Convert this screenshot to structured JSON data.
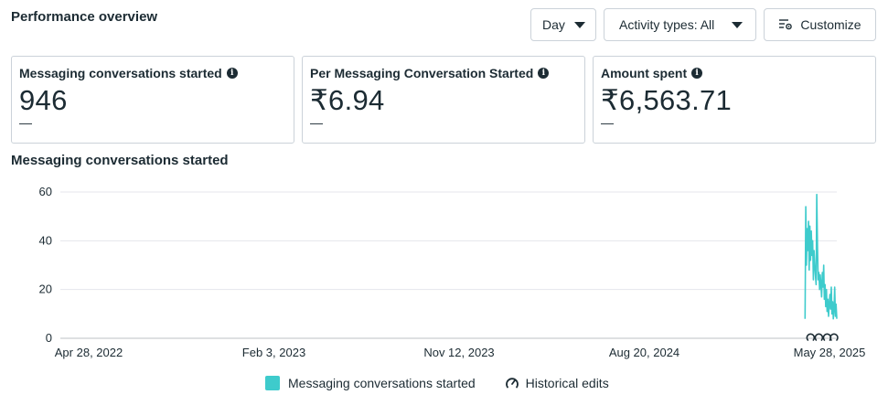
{
  "header": {
    "title": "Performance overview",
    "day_button": "Day",
    "activity_button": "Activity types: All",
    "customize_button": "Customize"
  },
  "metrics": [
    {
      "label": "Messaging conversations started",
      "value": "946",
      "sub": "—"
    },
    {
      "label": "Per Messaging Conversation Started",
      "value": "₹6.94",
      "sub": "—"
    },
    {
      "label": "Amount spent",
      "value": "₹6,563.71",
      "sub": "—"
    }
  ],
  "chart_title": "Messaging conversations started",
  "legend": {
    "series_label": "Messaging conversations started",
    "edits_label": "Historical edits"
  },
  "colors": {
    "series": "#3ecbcc",
    "grid": "#e4e6eb",
    "border": "#cbd2d9",
    "text": "#1c2b33"
  },
  "chart_data": {
    "type": "line",
    "x_tick_labels": [
      "Apr 28, 2022",
      "Feb 3, 2023",
      "Nov 12, 2023",
      "Aug 20, 2024",
      "May 28, 2025"
    ],
    "y_ticks": [
      0,
      20,
      40,
      60
    ],
    "ylim": [
      0,
      60
    ],
    "xlim": [
      "2022-04-28",
      "2025-05-28"
    ],
    "grid": true,
    "series": [
      {
        "name": "Messaging conversations started",
        "x": [
          "2025-04-12",
          "2025-04-13",
          "2025-04-14",
          "2025-04-15",
          "2025-04-16",
          "2025-04-17",
          "2025-04-18",
          "2025-04-19",
          "2025-04-20",
          "2025-04-21",
          "2025-04-22",
          "2025-04-23",
          "2025-04-24",
          "2025-04-25",
          "2025-04-26",
          "2025-04-27",
          "2025-04-28",
          "2025-04-29",
          "2025-04-30",
          "2025-05-01",
          "2025-05-02",
          "2025-05-03",
          "2025-05-04",
          "2025-05-05",
          "2025-05-06",
          "2025-05-07",
          "2025-05-08",
          "2025-05-09",
          "2025-05-10",
          "2025-05-11",
          "2025-05-12",
          "2025-05-13",
          "2025-05-14",
          "2025-05-15",
          "2025-05-16",
          "2025-05-17",
          "2025-05-18",
          "2025-05-19",
          "2025-05-20",
          "2025-05-21",
          "2025-05-22",
          "2025-05-23",
          "2025-05-24",
          "2025-05-25",
          "2025-05-26",
          "2025-05-27",
          "2025-05-28"
        ],
        "values": [
          8,
          54,
          30,
          45,
          36,
          48,
          28,
          46,
          32,
          44,
          34,
          40,
          24,
          36,
          30,
          26,
          22,
          59,
          38,
          24,
          27,
          20,
          26,
          22,
          17,
          27,
          21,
          30,
          16,
          22,
          13,
          20,
          11,
          16,
          9,
          14,
          18,
          12,
          21,
          10,
          15,
          8,
          12,
          21,
          9,
          14,
          8
        ]
      }
    ],
    "historical_edits": [
      "2025-04-20",
      "2025-05-02",
      "2025-05-14",
      "2025-05-24"
    ]
  }
}
